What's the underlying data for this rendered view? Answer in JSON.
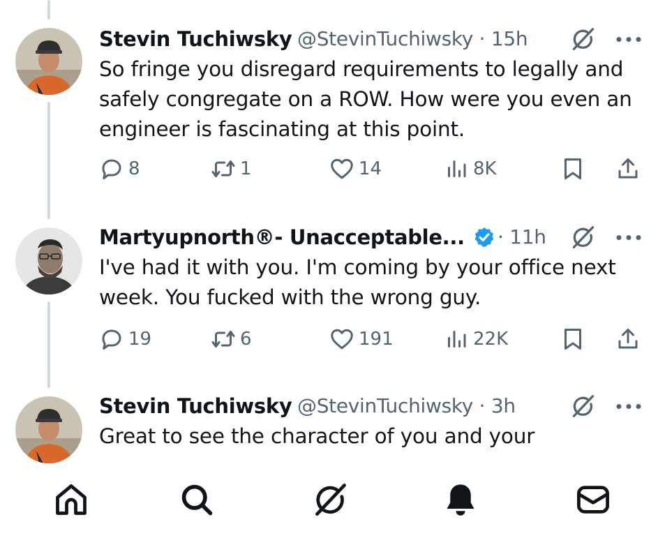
{
  "tweets": [
    {
      "name": "Stevin Tuchiwsky",
      "handle_time": "@StevinTuchiwsky · 15h",
      "text": "So fringe you disregard requirements to legally and safely congregate on a ROW. How were you even an engineer is fascinating at this point.",
      "replies": "8",
      "reposts": "1",
      "likes": "14",
      "views": "8K"
    },
    {
      "name": "Martyupnorth®- Unacceptable...",
      "handle_time": "· 11h",
      "verified": true,
      "text": "I've had it with you. I'm coming by your office next week. You fucked with the wrong guy.",
      "replies": "19",
      "reposts": "6",
      "likes": "191",
      "views": "22K"
    },
    {
      "name": "Stevin Tuchiwsky",
      "handle_time": "@StevinTuchiwsky · 3h",
      "text": "Great to see the character of you and your"
    }
  ],
  "icons": {
    "reply": "reply-icon",
    "repost": "repost-icon",
    "like": "heart-icon",
    "views": "views-icon",
    "bookmark": "bookmark-icon",
    "share": "share-icon",
    "grok": "grok-icon",
    "more": "more-icon"
  },
  "nav": [
    "home-icon",
    "search-icon",
    "grok-icon",
    "notifications-icon",
    "messages-icon"
  ],
  "colors": {
    "text": "#0f1419",
    "secondary": "#536471",
    "verified": "#1d9bf0",
    "thread_line": "#cfd9de"
  }
}
